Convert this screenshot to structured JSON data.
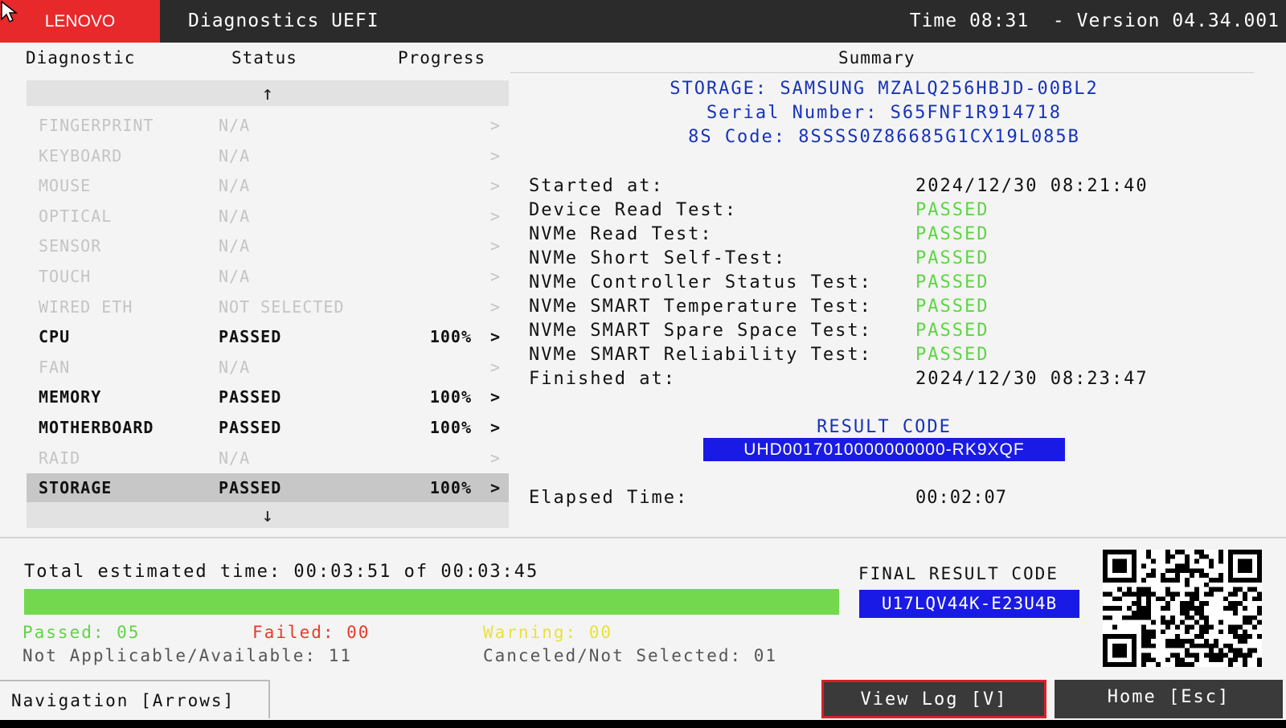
{
  "header": {
    "brand": "LENOVO",
    "title": "Diagnostics UEFI",
    "time_version": "Time 08:31  - Version 04.34.001"
  },
  "columns": {
    "diagnostic": "Diagnostic",
    "status": "Status",
    "progress": "Progress",
    "summary": "Summary"
  },
  "scroll": {
    "up": "↑",
    "down": "↓"
  },
  "diagnostics": [
    {
      "name": "FINGERPRINT",
      "status": "N/A",
      "progress": "",
      "arrow": ">"
    },
    {
      "name": "KEYBOARD",
      "status": "N/A",
      "progress": "",
      "arrow": ">"
    },
    {
      "name": "MOUSE",
      "status": "N/A",
      "progress": "",
      "arrow": ">"
    },
    {
      "name": "OPTICAL",
      "status": "N/A",
      "progress": "",
      "arrow": ">"
    },
    {
      "name": "SENSOR",
      "status": "N/A",
      "progress": "",
      "arrow": ">"
    },
    {
      "name": "TOUCH",
      "status": "N/A",
      "progress": "",
      "arrow": ">"
    },
    {
      "name": "WIRED ETH",
      "status": "NOT SELECTED",
      "progress": "",
      "arrow": ">"
    },
    {
      "name": "CPU",
      "status": "PASSED",
      "progress": "100%",
      "arrow": ">"
    },
    {
      "name": "FAN",
      "status": "N/A",
      "progress": "",
      "arrow": ">"
    },
    {
      "name": "MEMORY",
      "status": "PASSED",
      "progress": "100%",
      "arrow": ">"
    },
    {
      "name": "MOTHERBOARD",
      "status": "PASSED",
      "progress": "100%",
      "arrow": ">"
    },
    {
      "name": "RAID",
      "status": "N/A",
      "progress": "",
      "arrow": ">"
    },
    {
      "name": "STORAGE",
      "status": "PASSED",
      "progress": "100%",
      "arrow": ">"
    }
  ],
  "summary": {
    "storage": "STORAGE: SAMSUNG MZALQ256HBJD-00BL2",
    "serial": "Serial Number: S65FNF1R914718",
    "code_8s": "8S Code: 8SSSS0Z86685G1CX19L085B",
    "results": [
      {
        "label": "Started at:",
        "value": "2024/12/30 08:21:40",
        "passed": false
      },
      {
        "label": "Device Read Test:",
        "value": "PASSED",
        "passed": true
      },
      {
        "label": "NVMe Read Test:",
        "value": "PASSED",
        "passed": true
      },
      {
        "label": "NVMe Short Self-Test:",
        "value": "PASSED",
        "passed": true
      },
      {
        "label": "NVMe Controller Status Test:",
        "value": "PASSED",
        "passed": true
      },
      {
        "label": "NVMe SMART Temperature Test:",
        "value": "PASSED",
        "passed": true
      },
      {
        "label": "NVMe SMART Spare Space Test:",
        "value": "PASSED",
        "passed": true
      },
      {
        "label": "NVMe SMART Reliability Test:",
        "value": "PASSED",
        "passed": true
      },
      {
        "label": "Finished at:",
        "value": "2024/12/30 08:23:47",
        "passed": false
      }
    ],
    "result_code_title": "RESULT CODE",
    "result_code": "UHD0017010000000000-RK9XQF",
    "elapsed_label": "Elapsed Time:",
    "elapsed_value": "00:02:07"
  },
  "bottom": {
    "total_time": "Total estimated time: 00:03:51 of 00:03:45",
    "progress_percent": 100,
    "passed": "Passed: 05",
    "failed": "Failed: 00",
    "warning": "Warning: 00",
    "not_applicable": "Not Applicable/Available: 11",
    "canceled": "Canceled/Not Selected: 01",
    "final_result_label": "FINAL RESULT CODE",
    "final_result_code": "U17LQV44K-E23U4B"
  },
  "footer": {
    "navigation": "Navigation [Arrows]",
    "view_log": "View Log [V]",
    "home": "Home [Esc]"
  },
  "colors": {
    "brand": "#e8292c",
    "header": "#2b2b2b",
    "accent_blue": "#1733b8",
    "code_box": "#1a1ae6",
    "passed": "#5fd445",
    "failed": "#e83a2a",
    "warning": "#e8e23a",
    "progress": "#74d84f"
  }
}
